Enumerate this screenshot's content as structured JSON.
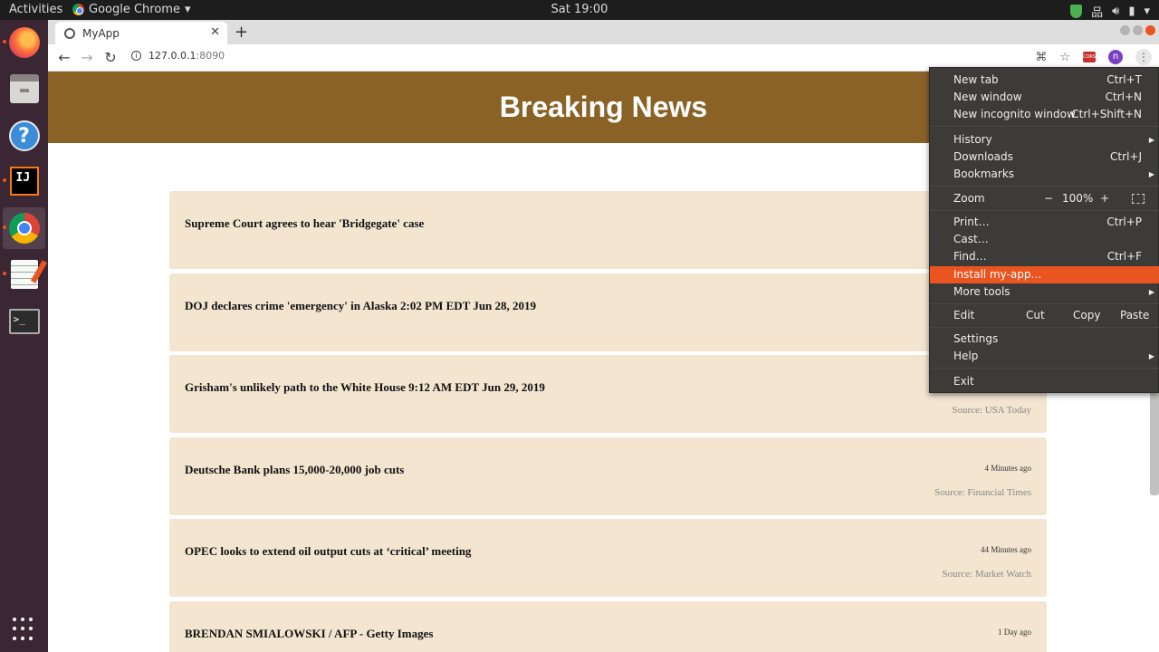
{
  "topbar": {
    "activities": "Activities",
    "app_name": "Google Chrome",
    "clock": "Sat 19:00",
    "tray": [
      "shield-icon",
      "network-icon",
      "volume-icon",
      "battery-icon"
    ]
  },
  "dock": {
    "items": [
      "firefox",
      "files",
      "help",
      "intellij",
      "chrome",
      "text-editor",
      "terminal",
      "show-applications"
    ],
    "help_glyph": "?",
    "ij_glyph": "IJ",
    "term_glyph": ">_"
  },
  "browser": {
    "tab_title": "MyApp",
    "url_host": "127.0.0.1",
    "url_port": ":8090",
    "profile_initial": "n",
    "cors_badge": "CORS"
  },
  "page": {
    "banner_title": "Breaking News",
    "news": [
      {
        "title": "Supreme Court agrees to hear 'Bridgegate' case",
        "time": "",
        "source": ""
      },
      {
        "title": "DOJ declares crime 'emergency' in Alaska 2:02 PM EDT Jun 28, 2019",
        "time": "",
        "source": ""
      },
      {
        "title": "Grisham's unlikely path to the White House 9:12 AM EDT Jun 29, 2019",
        "time": "",
        "source": "Source: USA Today"
      },
      {
        "title": "Deutsche Bank plans 15,000-20,000 job cuts",
        "time": "4 Minutes ago",
        "source": "Source: Financial Times"
      },
      {
        "title": "OPEC looks to extend oil output cuts at ‘critical’ meeting",
        "time": "44 Minutes ago",
        "source": "Source: Market Watch"
      },
      {
        "title": "BRENDAN SMIALOWSKI / AFP - Getty Images",
        "time": "1 Day ago",
        "source": ""
      }
    ]
  },
  "menu": {
    "new_tab": {
      "label": "New tab",
      "shortcut": "Ctrl+T"
    },
    "new_window": {
      "label": "New window",
      "shortcut": "Ctrl+N"
    },
    "new_incognito": {
      "label": "New incognito window",
      "shortcut": "Ctrl+Shift+N"
    },
    "history": {
      "label": "History"
    },
    "downloads": {
      "label": "Downloads",
      "shortcut": "Ctrl+J"
    },
    "bookmarks": {
      "label": "Bookmarks"
    },
    "zoom": {
      "label": "Zoom",
      "minus": "−",
      "value": "100%",
      "plus": "+"
    },
    "print": {
      "label": "Print…",
      "shortcut": "Ctrl+P"
    },
    "cast": {
      "label": "Cast…"
    },
    "find": {
      "label": "Find…",
      "shortcut": "Ctrl+F"
    },
    "install": {
      "label": "Install my-app…"
    },
    "more_tools": {
      "label": "More tools"
    },
    "edit": {
      "label": "Edit",
      "cut": "Cut",
      "copy": "Copy",
      "paste": "Paste"
    },
    "settings": {
      "label": "Settings"
    },
    "help": {
      "label": "Help"
    },
    "exit": {
      "label": "Exit"
    }
  },
  "colors": {
    "banner": "#8a6226",
    "card": "#f3e5d0",
    "menu_bg": "#3c3b37",
    "menu_highlight": "#e95420",
    "dock": "#3b2634"
  }
}
